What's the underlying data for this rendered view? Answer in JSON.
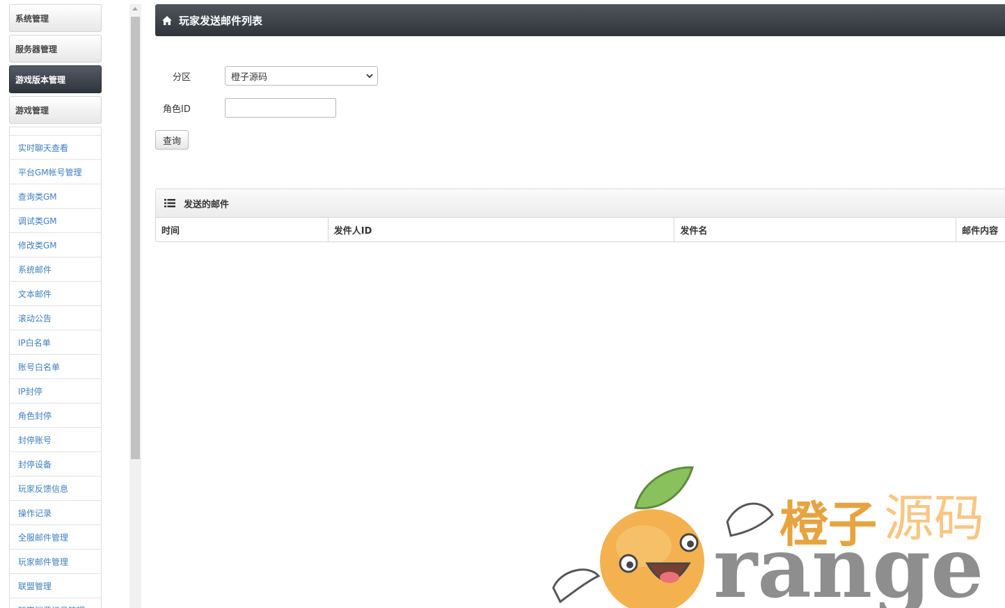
{
  "sidebar": {
    "categories": [
      {
        "label": "系统管理",
        "active": false
      },
      {
        "label": "服务器管理",
        "active": false
      },
      {
        "label": "游戏版本管理",
        "active": true
      },
      {
        "label": "游戏管理",
        "active": false
      }
    ],
    "items": [
      "实时聊天查看",
      "平台GM帐号管理",
      "查询类GM",
      "调试类GM",
      "修改类GM",
      "系统邮件",
      "文本邮件",
      "滚动公告",
      "IP白名单",
      "账号白名单",
      "IP封停",
      "角色封停",
      "封停账号",
      "封停设备",
      "玩家反馈信息",
      "操作记录",
      "全服邮件管理",
      "玩家邮件管理",
      "联盟管理",
      "玩家消费记录管理"
    ]
  },
  "header": {
    "title": "玩家发送邮件列表",
    "icon": "home-icon"
  },
  "form": {
    "zone_label": "分区",
    "zone_value": "橙子源码",
    "role_label": "角色ID",
    "role_value": "",
    "query_button": "查询"
  },
  "panel": {
    "title": "发送的邮件",
    "icon": "list-icon",
    "columns": [
      "时间",
      "发件人ID",
      "发件名",
      "邮件内容"
    ]
  },
  "watermark": {
    "cn_text_1": "橙子",
    "cn_text_2": "源码",
    "en_text": "range"
  },
  "colors": {
    "header_bg": "#3a3e45",
    "link": "#3d7fc1",
    "active_bg": "#3a3f47",
    "watermark_orange": "#f0a43b"
  }
}
